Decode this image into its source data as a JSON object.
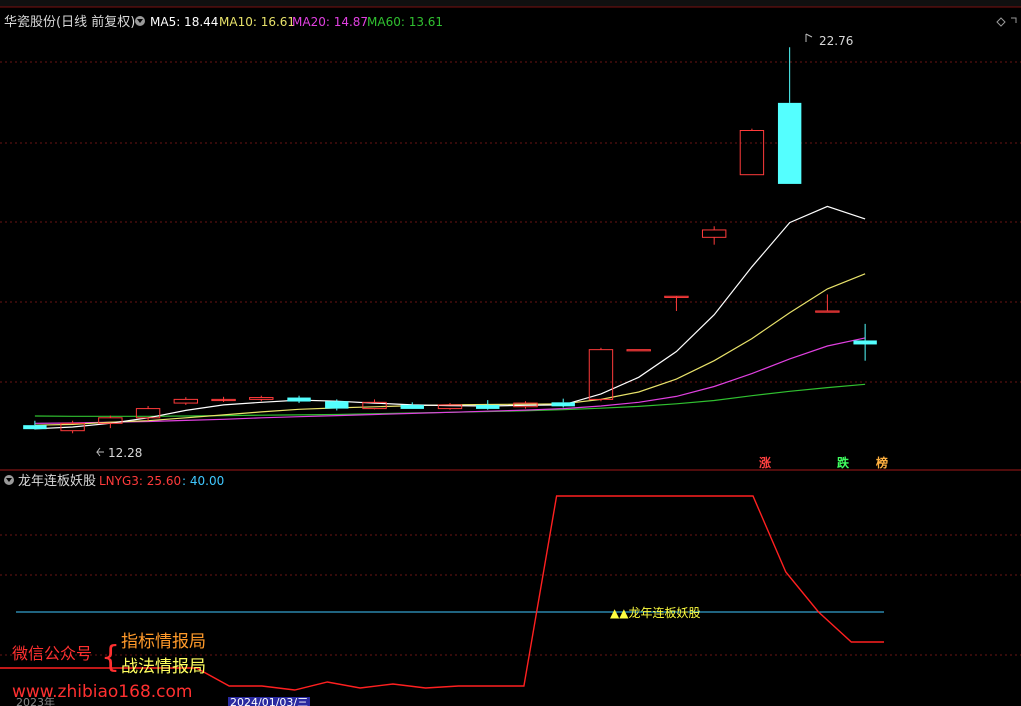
{
  "header": {
    "stock_title": "华瓷股份(日线 前复权)",
    "ma5": "MA5: 18.44",
    "ma10": "MA10: 16.61",
    "ma20": "MA20: 14.87",
    "ma60": "MA60: 13.61"
  },
  "sub_header": {
    "indicator_name": "龙年连板妖股",
    "lnyg3": "LNYG3: 25.60",
    "threshold": ": 40.00"
  },
  "annotations": {
    "high_price": "22.76",
    "low_price": "12.28",
    "tag_zhang": "涨",
    "tag_die": "跌",
    "tag_bang": "榜",
    "signal_label": "▲▲龙年连板妖股"
  },
  "watermark": {
    "account_label": "微信公众号",
    "brace": "{",
    "line1": "指标情报局",
    "line2": "战法情报局",
    "url": "www.zhibiao168.com"
  },
  "footer": {
    "year_label": "2023年",
    "date_label": "2024/01/03/三"
  },
  "colors": {
    "up": "#ff3b3b",
    "down": "#54ffff",
    "ma5": "#ffffff",
    "ma10": "#e8e26a",
    "ma20": "#e040e0",
    "ma60": "#30c030",
    "indicator": "#ff2020",
    "threshold": "#40c8ff"
  },
  "chart_data": [
    {
      "type": "candlestick",
      "ylim": [
        11.5,
        23.5
      ],
      "candles": [
        {
          "o": 12.5,
          "c": 12.45,
          "h": 12.62,
          "l": 12.38
        },
        {
          "o": 12.35,
          "c": 12.55,
          "h": 12.62,
          "l": 12.28
        },
        {
          "o": 12.55,
          "c": 12.7,
          "h": 12.76,
          "l": 12.42
        },
        {
          "o": 12.7,
          "c": 12.95,
          "h": 13.02,
          "l": 12.62
        },
        {
          "o": 13.1,
          "c": 13.2,
          "h": 13.26,
          "l": 13.05
        },
        {
          "o": 13.2,
          "c": 13.2,
          "h": 13.27,
          "l": 13.13
        },
        {
          "o": 13.2,
          "c": 13.25,
          "h": 13.3,
          "l": 13.15
        },
        {
          "o": 13.25,
          "c": 13.15,
          "h": 13.3,
          "l": 13.1
        },
        {
          "o": 13.15,
          "c": 12.95,
          "h": 13.2,
          "l": 12.9
        },
        {
          "o": 12.95,
          "c": 13.12,
          "h": 13.2,
          "l": 12.93
        },
        {
          "o": 13.05,
          "c": 13.0,
          "h": 13.12,
          "l": 12.95
        },
        {
          "o": 12.95,
          "c": 13.05,
          "h": 13.1,
          "l": 12.92
        },
        {
          "o": 13.05,
          "c": 13.0,
          "h": 13.18,
          "l": 12.92
        },
        {
          "o": 13.0,
          "c": 13.1,
          "h": 13.15,
          "l": 12.95
        },
        {
          "o": 13.12,
          "c": 13.05,
          "h": 13.22,
          "l": 12.98
        },
        {
          "o": 13.2,
          "c": 14.55,
          "h": 14.6,
          "l": 13.15
        },
        {
          "o": 14.55,
          "c": 14.55,
          "h": 14.55,
          "l": 14.55
        },
        {
          "o": 16.0,
          "c": 16.0,
          "h": 16.0,
          "l": 15.6
        },
        {
          "o": 17.6,
          "c": 17.8,
          "h": 17.9,
          "l": 17.4
        },
        {
          "o": 19.3,
          "c": 20.5,
          "h": 20.55,
          "l": 19.3
        },
        {
          "o": 21.25,
          "c": 19.05,
          "h": 22.76,
          "l": 19.05
        },
        {
          "o": 15.6,
          "c": 15.6,
          "h": 16.05,
          "l": 15.6
        },
        {
          "o": 14.8,
          "c": 14.7,
          "h": 15.25,
          "l": 14.25
        }
      ],
      "ma5": [
        12.4,
        12.45,
        12.55,
        12.7,
        12.9,
        13.05,
        13.12,
        13.18,
        13.15,
        13.1,
        13.05,
        13.03,
        13.02,
        13.04,
        13.05,
        13.35,
        13.8,
        14.5,
        15.5,
        16.8,
        18.0,
        18.44,
        18.1
      ],
      "ma10": [
        12.5,
        12.52,
        12.58,
        12.62,
        12.7,
        12.78,
        12.86,
        12.93,
        12.97,
        13.0,
        13.03,
        13.05,
        13.06,
        13.07,
        13.08,
        13.2,
        13.4,
        13.75,
        14.25,
        14.85,
        15.55,
        16.2,
        16.61
      ],
      "ma20": [
        12.55,
        12.56,
        12.58,
        12.6,
        12.63,
        12.66,
        12.7,
        12.73,
        12.76,
        12.79,
        12.82,
        12.85,
        12.88,
        12.91,
        12.95,
        13.02,
        13.12,
        13.28,
        13.55,
        13.9,
        14.3,
        14.65,
        14.87
      ],
      "ma60": [
        12.75,
        12.74,
        12.74,
        12.74,
        12.75,
        12.76,
        12.77,
        12.78,
        12.79,
        12.81,
        12.83,
        12.85,
        12.87,
        12.89,
        12.92,
        12.96,
        13.01,
        13.08,
        13.17,
        13.3,
        13.42,
        13.52,
        13.61
      ]
    },
    {
      "type": "line",
      "ylim": [
        0,
        100
      ],
      "series": [
        {
          "name": "LNYG3",
          "values": [
            12,
            12,
            12,
            12,
            12,
            12,
            12,
            3,
            3,
            1,
            5,
            2,
            4,
            2,
            3,
            3,
            3,
            98,
            98,
            98,
            98,
            98,
            98,
            98,
            60,
            40,
            25,
            25
          ]
        }
      ],
      "threshold": 40.0
    }
  ]
}
